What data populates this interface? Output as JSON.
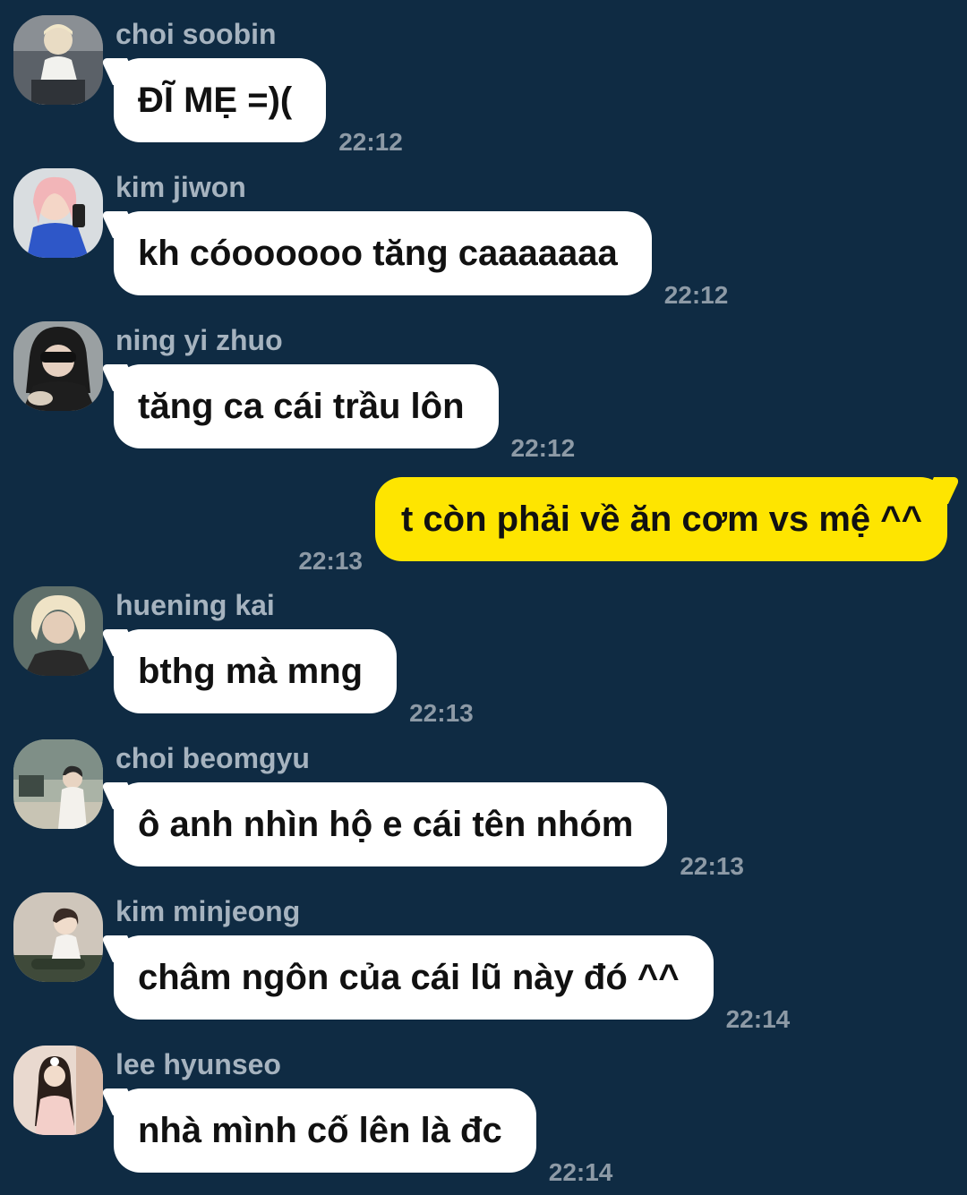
{
  "chat": {
    "messages": [
      {
        "sender": "choi soobin",
        "text": "ĐĨ MẸ =)(",
        "time": "22:12",
        "avatar": "avatar-photo"
      },
      {
        "sender": "kim jiwon",
        "text": "kh cóoooooo tăng caaaaaaa",
        "time": "22:12",
        "avatar": "avatar-photo"
      },
      {
        "sender": "ning yi zhuo",
        "text": "tăng ca cái trầu lôn",
        "time": "22:12",
        "avatar": "avatar-photo"
      },
      {
        "sender": "huening kai",
        "text": "bthg mà mng",
        "time": "22:13",
        "avatar": "avatar-photo"
      },
      {
        "sender": "choi beomgyu",
        "text": "ô anh nhìn hộ e cái tên nhóm",
        "time": "22:13",
        "avatar": "avatar-photo"
      },
      {
        "sender": "kim minjeong",
        "text": "châm ngôn của cái lũ này đó ^^",
        "time": "22:14",
        "avatar": "avatar-photo"
      },
      {
        "sender": "lee hyunseo",
        "text": "nhà mình cố lên là đc",
        "time": "22:14",
        "avatar": "avatar-photo"
      }
    ],
    "own_message": {
      "text": "t còn phải về ăn cơm vs mệ ^^",
      "time": "22:13"
    }
  },
  "colors": {
    "background": "#0f2b43",
    "incoming_bubble": "#ffffff",
    "outgoing_bubble": "#fee500",
    "sender_name": "#a6b3bf",
    "timestamp": "#8d9aa6"
  }
}
